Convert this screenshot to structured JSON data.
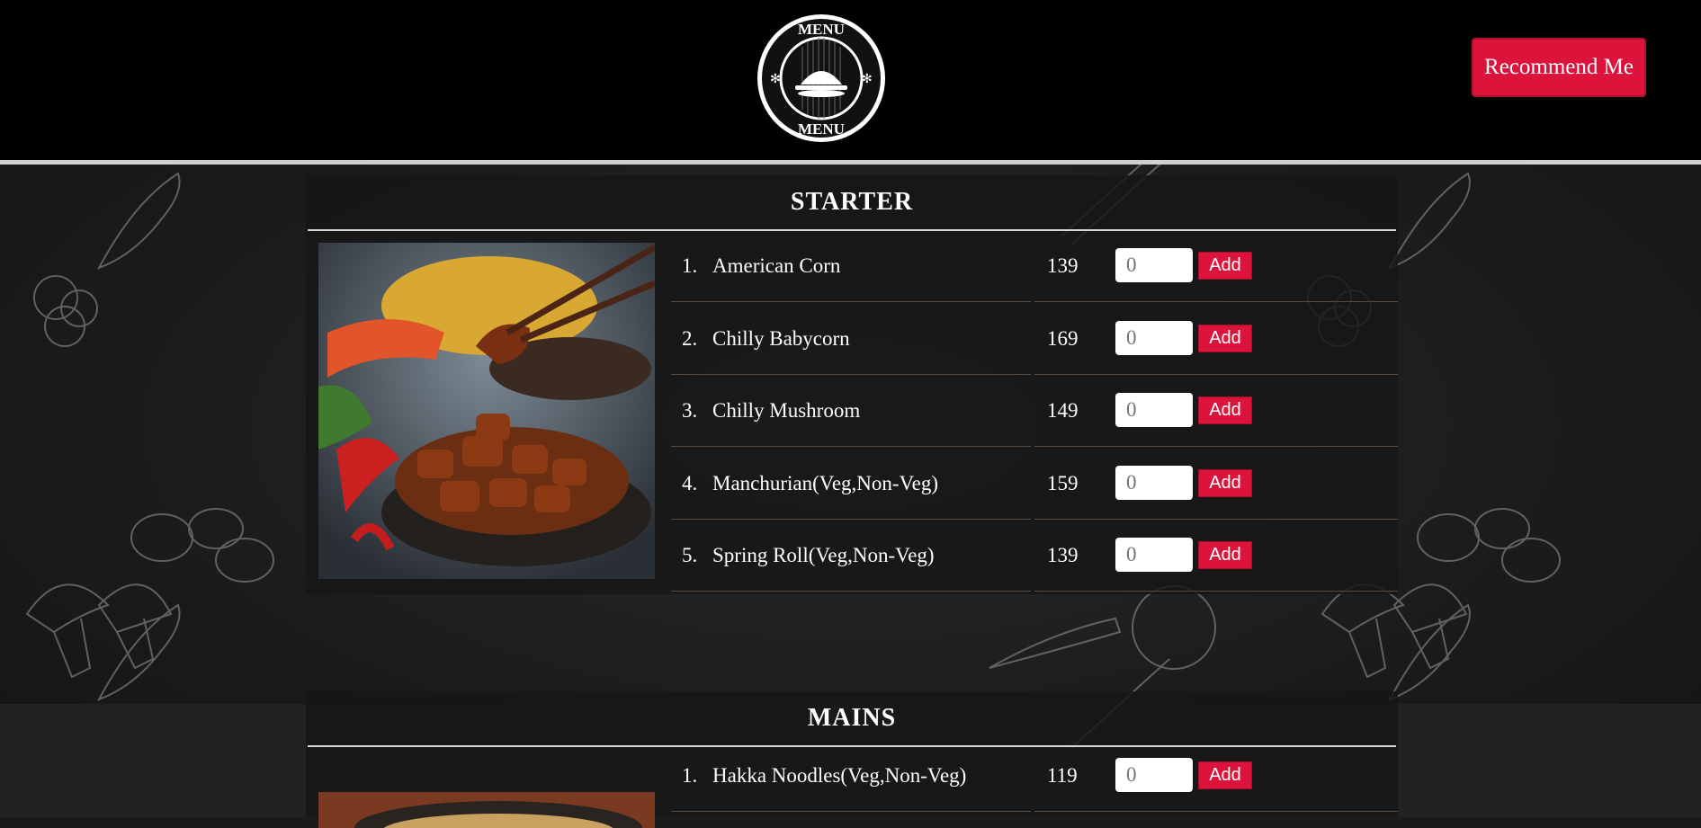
{
  "header": {
    "logo_top_text": "MENU",
    "logo_bottom_text": "MENU",
    "recommend_label": "Recommend Me"
  },
  "colors": {
    "accent": "#dc143c",
    "header_bg": "#000000",
    "board_bg": "#1c1c1c"
  },
  "starter": {
    "title": "STARTER",
    "items": [
      {
        "num": "1.",
        "name": "American Corn",
        "price": "139",
        "qty_placeholder": "0",
        "add_label": "Add"
      },
      {
        "num": "2.",
        "name": "Chilly Babycorn",
        "price": "169",
        "qty_placeholder": "0",
        "add_label": "Add"
      },
      {
        "num": "3.",
        "name": "Chilly Mushroom",
        "price": "149",
        "qty_placeholder": "0",
        "add_label": "Add"
      },
      {
        "num": "4.",
        "name": "Manchurian(Veg,Non-Veg)",
        "price": "159",
        "qty_placeholder": "0",
        "add_label": "Add"
      },
      {
        "num": "5.",
        "name": "Spring Roll(Veg,Non-Veg)",
        "price": "139",
        "qty_placeholder": "0",
        "add_label": "Add"
      }
    ]
  },
  "mains": {
    "title": "MAINS",
    "items": [
      {
        "num": "1.",
        "name": "Hakka Noodles(Veg,Non-Veg)",
        "price": "119",
        "qty_placeholder": "0",
        "add_label": "Add"
      }
    ]
  }
}
